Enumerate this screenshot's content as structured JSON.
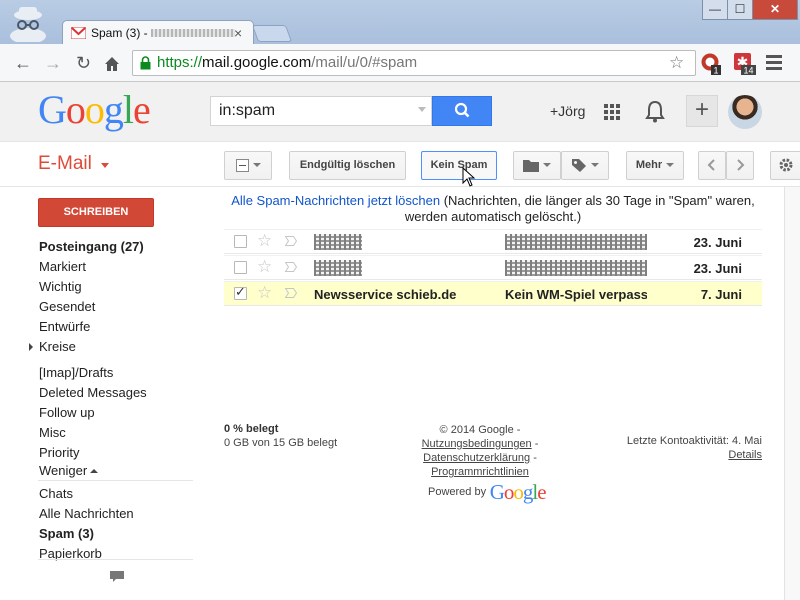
{
  "browser": {
    "tab_title": "Spam (3) -",
    "tab_close": "×",
    "window_min": "—",
    "window_max": "☐",
    "window_close": "✕",
    "url": {
      "scheme": "https://",
      "host": "mail.google.com",
      "path": "/mail/u/0/#spam"
    },
    "ext1_badge": "1",
    "ext2_badge": "14"
  },
  "header": {
    "logo_letters": [
      {
        "ch": "G",
        "color": "#4285f4"
      },
      {
        "ch": "o",
        "color": "#ea4335"
      },
      {
        "ch": "o",
        "color": "#fbbc05"
      },
      {
        "ch": "g",
        "color": "#4285f4"
      },
      {
        "ch": "l",
        "color": "#34a853"
      },
      {
        "ch": "e",
        "color": "#ea4335"
      }
    ],
    "search_value": "in:spam",
    "user_link": "+Jörg",
    "plus_label": "+"
  },
  "mailbar": {
    "app_label": "E-Mail",
    "delete_label": "Endgültig löschen",
    "not_spam_label": "Kein Spam",
    "more_label": "Mehr"
  },
  "nav": {
    "compose_label": "SCHREIBEN",
    "items": [
      {
        "label": "Posteingang (27)",
        "bold": true
      },
      {
        "label": "Markiert",
        "bold": false
      },
      {
        "label": "Wichtig",
        "bold": false
      },
      {
        "label": "Gesendet",
        "bold": false
      },
      {
        "label": "Entwürfe",
        "bold": false
      },
      {
        "label": "Kreise",
        "bold": false
      }
    ],
    "labels": [
      {
        "label": "[Imap]/Drafts"
      },
      {
        "label": "Deleted Messages"
      },
      {
        "label": "Follow up"
      },
      {
        "label": "Misc"
      },
      {
        "label": "Priority"
      }
    ],
    "less_label": "Weniger",
    "more_items": [
      {
        "label": "Chats",
        "bold": false
      },
      {
        "label": "Alle Nachrichten",
        "bold": false
      },
      {
        "label": "Spam (3)",
        "bold": true
      },
      {
        "label": "Papierkorb",
        "bold": false
      }
    ]
  },
  "main": {
    "spam_link": "Alle Spam-Nachrichten jetzt löschen",
    "spam_note": " (Nachrichten, die länger als 30 Tage in \"Spam\" waren, werden automatisch gelöscht.)",
    "rows": [
      {
        "sender": "",
        "subject": "",
        "date": "23. Juni",
        "checked": false,
        "selected": false,
        "redacted": true
      },
      {
        "sender": "",
        "subject": "",
        "date": "23. Juni",
        "checked": false,
        "selected": false,
        "redacted": true
      },
      {
        "sender": "Newsservice schieb.de",
        "subject": "Kein WM-Spiel verpass",
        "date": "7. Juni",
        "checked": true,
        "selected": true,
        "redacted": false
      }
    ]
  },
  "footer": {
    "quota_percent": "0 % belegt",
    "quota_detail": "0 GB von 15 GB belegt",
    "copyright": "© 2014 Google -",
    "terms": "Nutzungsbedingungen",
    "privacy": "Datenschutzerklärung",
    "policies": "Programmrichtlinien",
    "sep": " -",
    "powered_by": "Powered by",
    "last_activity": "Letzte Kontoaktivität: 4. Mai",
    "details": "Details"
  },
  "colors": {
    "brand_red": "#dd4b39",
    "compose_red": "#d14836",
    "search_blue": "#4285f4",
    "link_blue": "#15c",
    "selected_row": "#ffffcc"
  },
  "icons": [
    "incognito-icon",
    "gmail-favicon",
    "back-arrow-icon",
    "forward-arrow-icon",
    "reload-icon",
    "home-icon",
    "lock-icon",
    "bookmark-star-icon",
    "search-icon",
    "apps-grid-icon",
    "bell-icon",
    "folder-icon",
    "label-tag-icon",
    "chevron-left-icon",
    "chevron-right-icon",
    "gear-icon",
    "star-icon",
    "importance-marker-icon",
    "chat-bubble-icon"
  ]
}
